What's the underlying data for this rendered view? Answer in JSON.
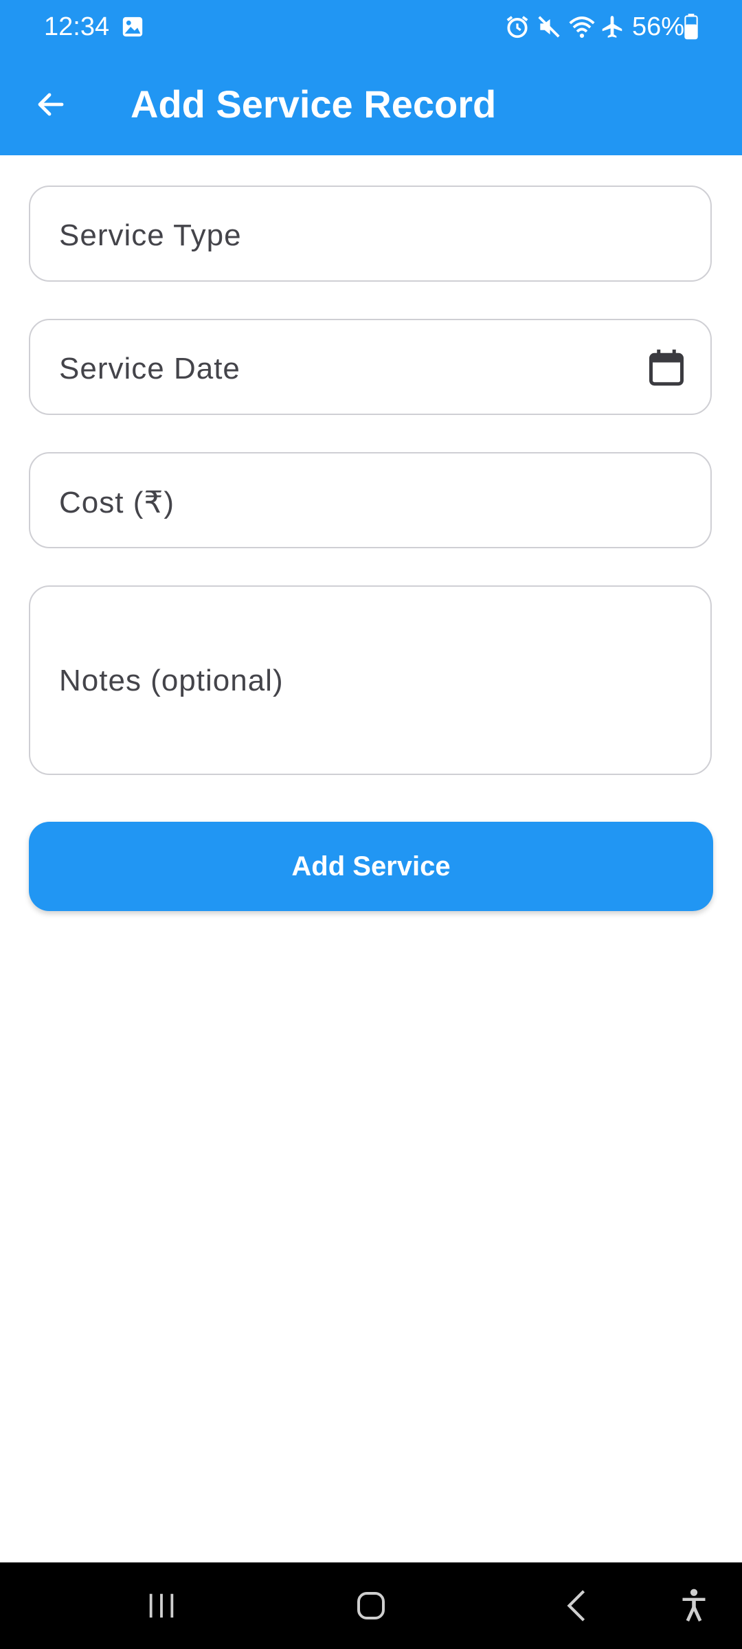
{
  "status_bar": {
    "time": "12:34",
    "battery": "56%",
    "icons": [
      "image-icon",
      "alarm-icon",
      "mute-icon",
      "wifi-icon",
      "airplane-icon",
      "battery-icon"
    ]
  },
  "app_bar": {
    "title": "Add Service Record",
    "back_icon": "arrow-left-icon"
  },
  "form": {
    "service_type": {
      "placeholder": "Service Type",
      "value": ""
    },
    "service_date": {
      "placeholder": "Service Date",
      "value": "",
      "icon": "calendar-icon"
    },
    "cost": {
      "placeholder": "Cost (₹)",
      "value": ""
    },
    "notes": {
      "placeholder": "Notes (optional)",
      "value": ""
    }
  },
  "submit": {
    "label": "Add Service"
  },
  "nav_bar": {
    "buttons": [
      "recent-apps-icon",
      "home-icon",
      "back-icon",
      "accessibility-icon"
    ]
  },
  "colors": {
    "primary": "#2196F3",
    "field_border": "#cfcfd4",
    "label_text": "#44444a",
    "background": "#ffffff"
  }
}
